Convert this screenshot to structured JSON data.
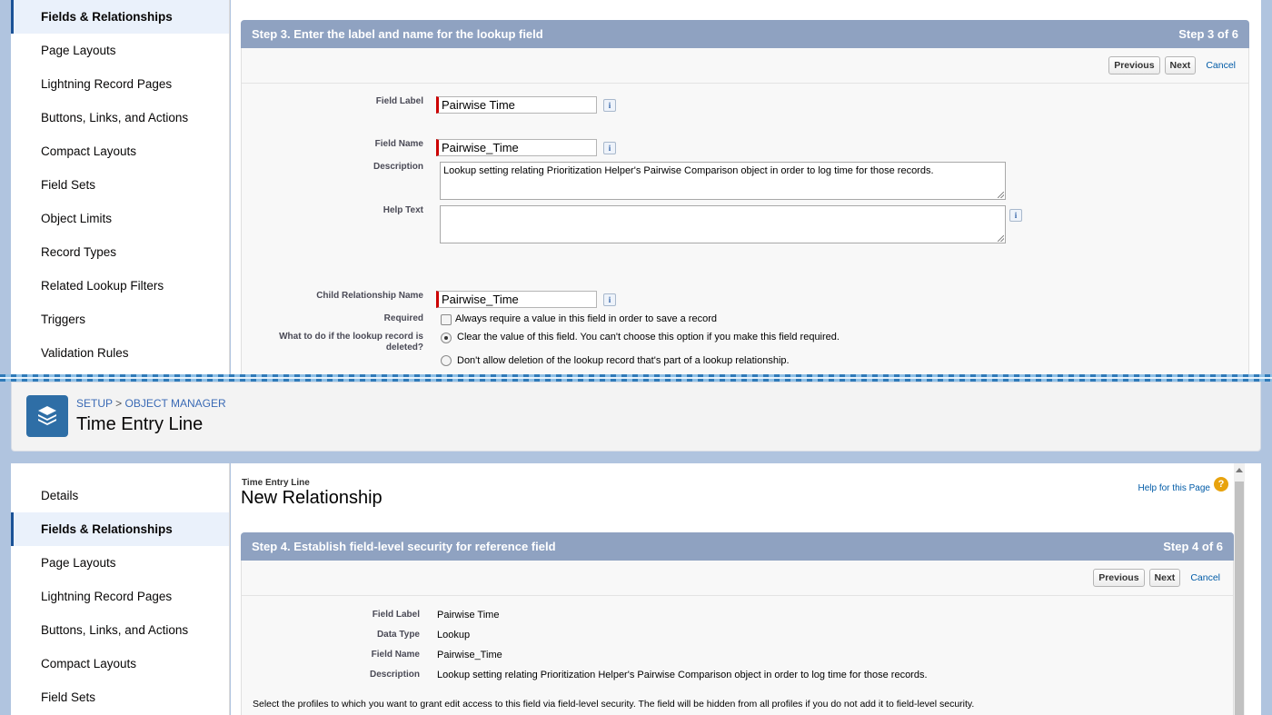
{
  "top": {
    "sidebar": [
      "Fields & Relationships",
      "Page Layouts",
      "Lightning Record Pages",
      "Buttons, Links, and Actions",
      "Compact Layouts",
      "Field Sets",
      "Object Limits",
      "Record Types",
      "Related Lookup Filters",
      "Triggers",
      "Validation Rules"
    ],
    "step_title": "Step 3. Enter the label and name for the lookup field",
    "step_count": "Step 3 of 6",
    "buttons": {
      "previous": "Previous",
      "next": "Next",
      "cancel": "Cancel"
    },
    "labels": {
      "field_label": "Field Label",
      "field_name": "Field Name",
      "description": "Description",
      "help_text": "Help Text",
      "child_rel": "Child Relationship Name",
      "required": "Required",
      "lookup_deleted": "What to do if the lookup record is deleted?"
    },
    "values": {
      "field_label": "Pairwise Time",
      "field_name": "Pairwise_Time",
      "description": "Lookup setting relating Prioritization Helper's Pairwise Comparison object in order to log time for those records.",
      "help_text": "",
      "child_rel": "Pairwise_Time"
    },
    "required_text": "Always require a value in this field in order to save a record",
    "option_clear": "Clear the value of this field. You can't choose this option if you make this field required.",
    "option_block": "Don't allow deletion of the lookup record that's part of a lookup relationship.",
    "info_glyph": "i"
  },
  "header": {
    "breadcrumb_setup": "SETUP",
    "breadcrumb_sep": ">",
    "breadcrumb_om": "OBJECT MANAGER",
    "title": "Time Entry Line",
    "icon": "layers-icon"
  },
  "bottom": {
    "sidebar": [
      "Details",
      "Fields & Relationships",
      "Page Layouts",
      "Lightning Record Pages",
      "Buttons, Links, and Actions",
      "Compact Layouts",
      "Field Sets"
    ],
    "object_label": "Time Entry Line",
    "page_title": "New Relationship",
    "help_link": "Help for this Page",
    "help_glyph": "?",
    "step_title": "Step 4. Establish field-level security for reference field",
    "step_count": "Step 4 of 6",
    "buttons": {
      "previous": "Previous",
      "next": "Next",
      "cancel": "Cancel"
    },
    "rows": [
      {
        "label": "Field Label",
        "value": "Pairwise Time"
      },
      {
        "label": "Data Type",
        "value": "Lookup"
      },
      {
        "label": "Field Name",
        "value": "Pairwise_Time"
      },
      {
        "label": "Description",
        "value": "Lookup setting relating Prioritization Helper's Pairwise Comparison object in order to log time for those records."
      }
    ],
    "note": "Select the profiles to which you want to grant edit access to this field via field-level security. The field will be hidden from all profiles if you do not add it to field-level security."
  },
  "colors": {
    "step_bar": "#8fa2c1",
    "accent": "#1b5297",
    "icon_bg": "#2e6ea6",
    "help_icon": "#e8a30e"
  }
}
